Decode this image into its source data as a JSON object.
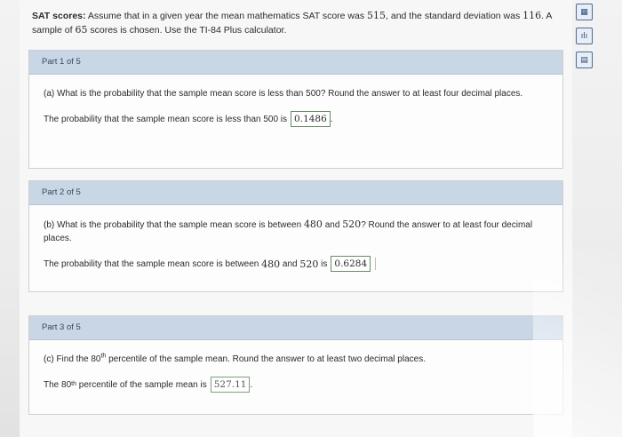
{
  "problem": {
    "label": "SAT scores:",
    "text_1": "Assume that in a given year the mean mathematics SAT score was",
    "mean": "515",
    "text_2": ", and the standard deviation was",
    "sd": "116",
    "text_3": ". A",
    "text_4": "sample of",
    "n": "65",
    "text_5": "scores is chosen. Use the TI-84 Plus calculator."
  },
  "parts": [
    {
      "header": "Part 1 of 5",
      "question": "(a) What is the probability that the sample mean score is less than 500? Round the answer to at least four decimal places.",
      "answer_prefix": "The probability that the sample mean score is less than 500 is",
      "answer": "0.1486",
      "answer_suffix": "."
    },
    {
      "header": "Part 2 of 5",
      "question_1": "(b) What is the probability that the sample mean score is between",
      "low": "480",
      "question_2": "and",
      "high": "520",
      "question_3": "? Round the answer to at least four decimal",
      "question_4": "places.",
      "answer_prefix": "The probability that the sample mean score is between",
      "answer_mid": "and",
      "answer_prefix_2": "is",
      "answer": "0.6284",
      "answer_suffix": "."
    },
    {
      "header": "Part 3 of 5",
      "question_1": "(c) Find the 80",
      "question_sup": "th",
      "question_2": "percentile of the sample mean. Round the answer to at least two decimal places.",
      "answer_prefix_1": "The 80",
      "answer_sup": "th",
      "answer_prefix_2": "percentile of the sample mean is",
      "answer": "527.11",
      "answer_suffix": "."
    }
  ],
  "toolbar": {
    "icons": [
      "calculator-icon",
      "distribution-icon",
      "book-icon"
    ]
  }
}
